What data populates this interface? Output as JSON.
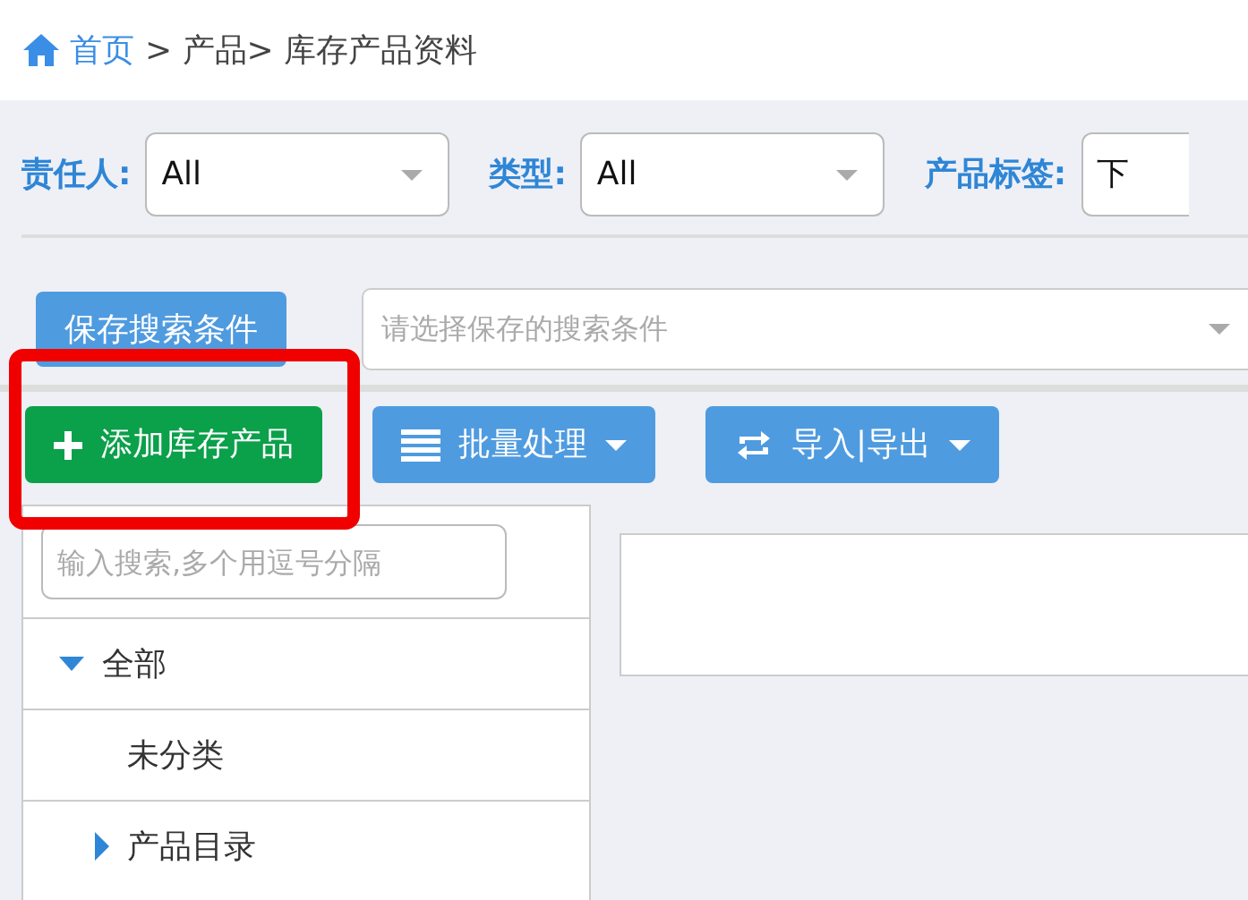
{
  "breadcrumb": {
    "home": "首页",
    "path": "> 产品> 库存产品资料"
  },
  "filters": [
    {
      "label": "责任人:",
      "value": "All"
    },
    {
      "label": "类型:",
      "value": "All"
    },
    {
      "label": "产品标签:",
      "value": "下"
    }
  ],
  "save_search_button": "保存搜索条件",
  "saved_search": {
    "placeholder": "请选择保存的搜索条件"
  },
  "toolbar": [
    {
      "label": "添加库存产品",
      "kind": "add",
      "highlighted": true
    },
    {
      "label": "批量处理",
      "kind": "menu",
      "highlighted": false
    },
    {
      "label": "导入|导出",
      "kind": "transfer",
      "highlighted": false
    }
  ],
  "tree_search": {
    "placeholder": "输入搜索,多个用逗号分隔"
  },
  "tree": [
    {
      "label": "全部",
      "expanded": true,
      "children": [
        {
          "label": "未分类"
        },
        {
          "label": "产品目录",
          "expanded": false
        }
      ]
    }
  ]
}
